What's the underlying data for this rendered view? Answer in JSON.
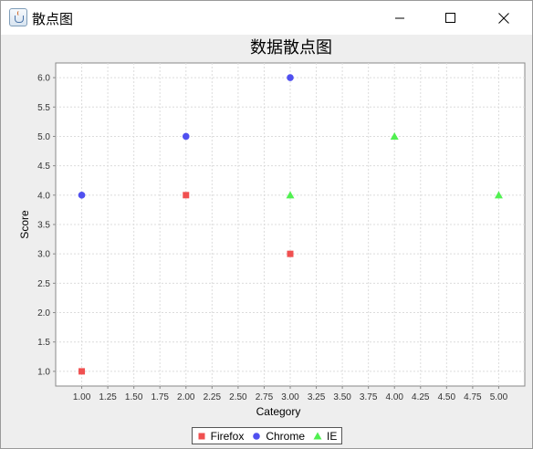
{
  "window": {
    "title": "散点图",
    "buttons": {
      "minimize": "minimize",
      "maximize": "maximize",
      "close": "close"
    }
  },
  "chart_data": {
    "type": "scatter",
    "title": "数据散点图",
    "xlabel": "Category",
    "ylabel": "Score",
    "xlim": [
      0.75,
      5.25
    ],
    "ylim": [
      0.75,
      6.25
    ],
    "x_ticks": [
      "1.00",
      "1.25",
      "1.50",
      "1.75",
      "2.00",
      "2.25",
      "2.50",
      "2.75",
      "3.00",
      "3.25",
      "3.50",
      "3.75",
      "4.00",
      "4.25",
      "4.50",
      "4.75",
      "5.00"
    ],
    "y_ticks": [
      "1.0",
      "1.5",
      "2.0",
      "2.5",
      "3.0",
      "3.5",
      "4.0",
      "4.5",
      "5.0",
      "5.5",
      "6.0"
    ],
    "grid": true,
    "legend_placement": "bottom",
    "series": [
      {
        "name": "Firefox",
        "marker": "square",
        "color": "#f05050",
        "points": [
          [
            1,
            1
          ],
          [
            2,
            4
          ],
          [
            3,
            3
          ]
        ]
      },
      {
        "name": "Chrome",
        "marker": "circle",
        "color": "#5050f0",
        "points": [
          [
            1,
            4
          ],
          [
            2,
            5
          ],
          [
            3,
            6
          ]
        ]
      },
      {
        "name": "IE",
        "marker": "triangle",
        "color": "#50f050",
        "points": [
          [
            3,
            4
          ],
          [
            4,
            5
          ],
          [
            5,
            4
          ]
        ]
      }
    ]
  }
}
